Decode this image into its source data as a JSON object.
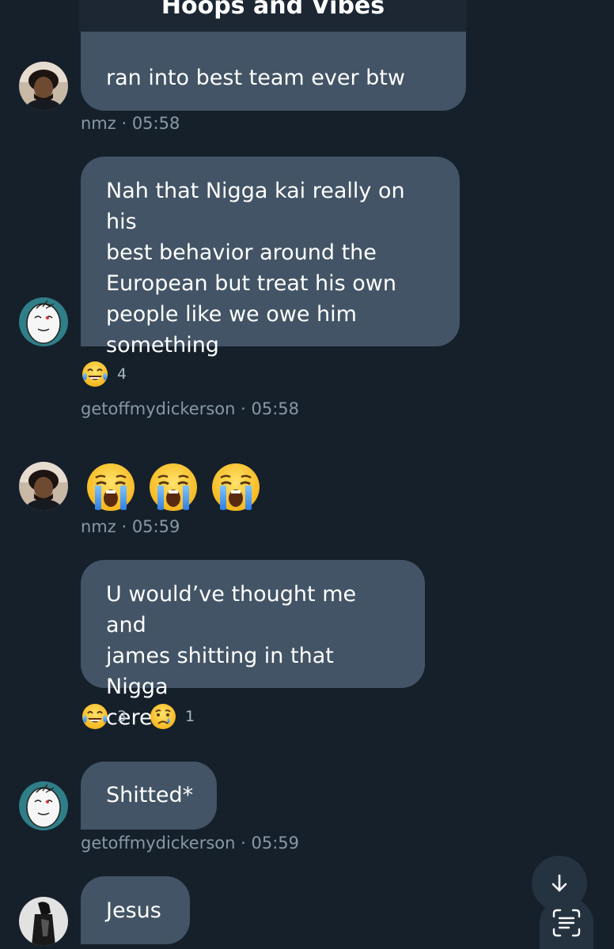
{
  "header": {
    "title": "Hoops and Vibes"
  },
  "messages": [
    {
      "id": "m1",
      "sender": "nmz",
      "text": "ran into best team ever btw",
      "meta": "nmz · 05:58"
    },
    {
      "id": "m2",
      "sender": "getoffmydickerson",
      "lines": [
        "Nah that Nigga kai really on his",
        "best behavior around the",
        "European but treat his own",
        "people like we owe him",
        "something"
      ],
      "reactions": [
        {
          "emoji": "joy",
          "count": "4"
        }
      ],
      "meta": "getoffmydickerson · 05:58"
    },
    {
      "id": "m3",
      "sender": "nmz",
      "emojis": [
        "loudly-crying",
        "loudly-crying",
        "loudly-crying"
      ],
      "meta": "nmz · 05:59"
    },
    {
      "id": "m4",
      "sender": "getoffmydickerson",
      "lines": [
        "U would’ve thought me and",
        "james shitting in that Nigga",
        "cereal"
      ],
      "reactions": [
        {
          "emoji": "joy",
          "count": "3"
        },
        {
          "emoji": "crying",
          "count": "1"
        }
      ]
    },
    {
      "id": "m5",
      "sender": "getoffmydickerson",
      "text": "Shitted*",
      "meta": "getoffmydickerson · 05:59"
    },
    {
      "id": "m6",
      "sender": "unknown",
      "text": "Jesus"
    }
  ],
  "controls": {
    "scroll_down_icon": "arrow-down-icon",
    "text_scan_icon": "text-scan-icon"
  },
  "colors": {
    "background": "#15202b",
    "bubble": "#425465",
    "meta_text": "#8899a6"
  }
}
